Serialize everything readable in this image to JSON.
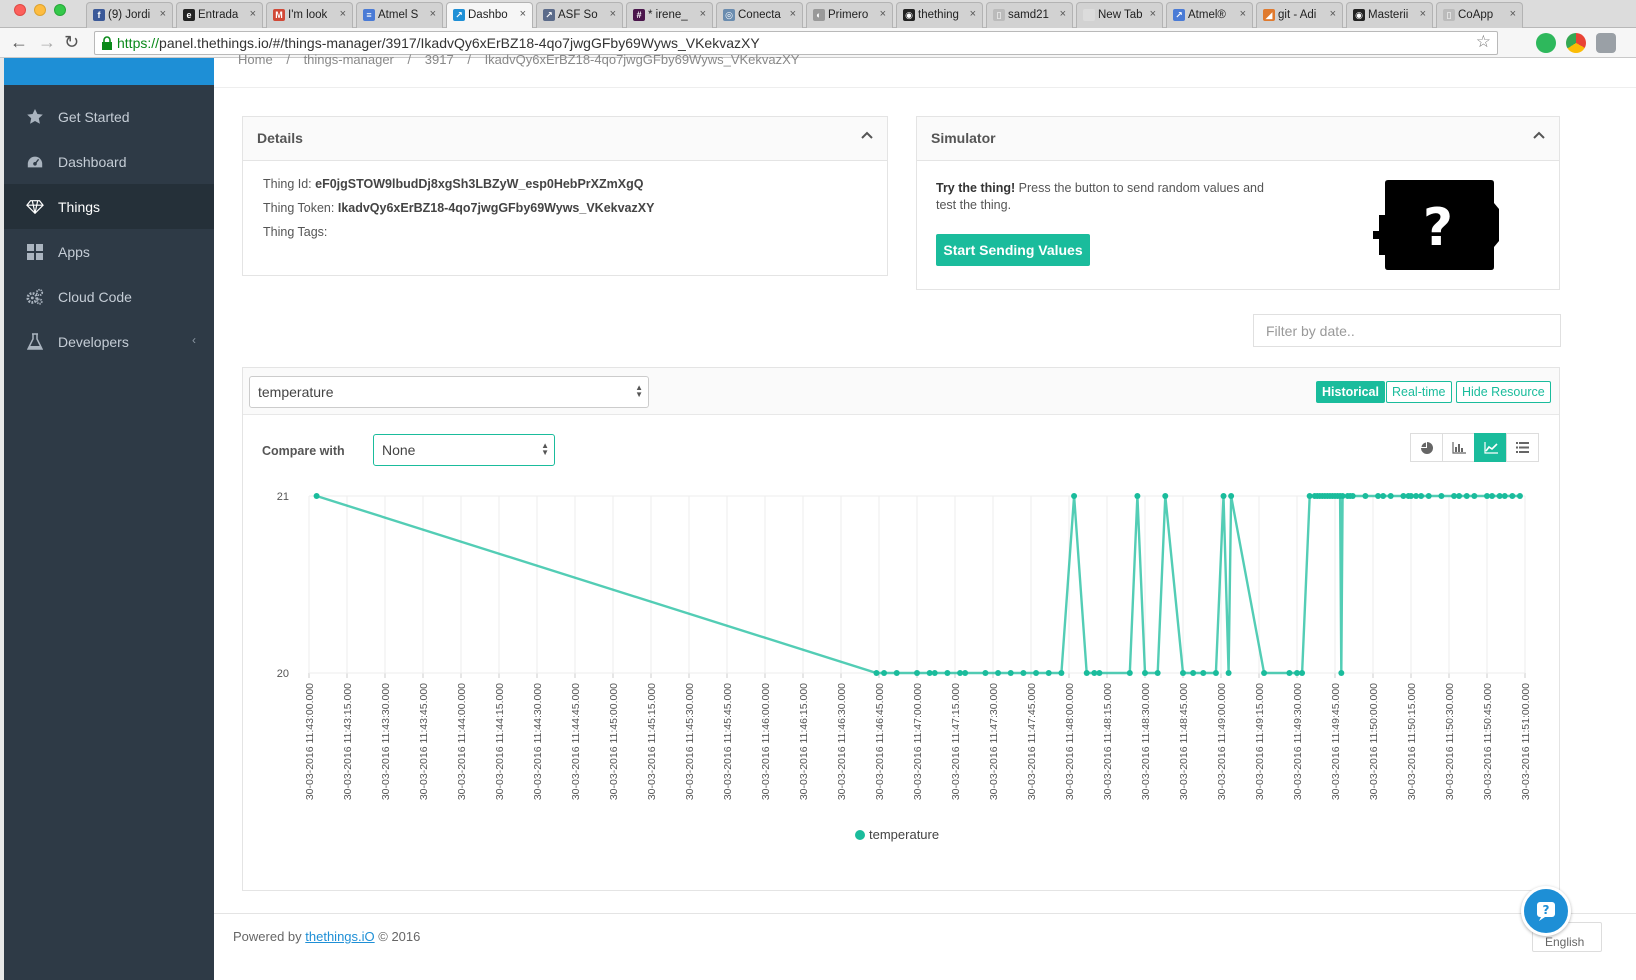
{
  "browser": {
    "tabs": [
      {
        "label": "(9) Jordi",
        "fav_color": "#3b5998",
        "fav_glyph": "f"
      },
      {
        "label": "Entrada",
        "fav_color": "#222222",
        "fav_glyph": "e"
      },
      {
        "label": "I'm look",
        "fav_color": "#d14836",
        "fav_glyph": "M"
      },
      {
        "label": "Atmel S",
        "fav_color": "#4a7bd6",
        "fav_glyph": "≡"
      },
      {
        "label": "Dashbo",
        "fav_color": "#1e8fd6",
        "fav_glyph": "↗",
        "active": true
      },
      {
        "label": "ASF So",
        "fav_color": "#5b6b8a",
        "fav_glyph": "↗"
      },
      {
        "label": "* irene_",
        "fav_color": "#4a154b",
        "fav_glyph": "#"
      },
      {
        "label": "Conecta",
        "fav_color": "#6a8caf",
        "fav_glyph": "◎"
      },
      {
        "label": "Primero",
        "fav_color": "#999999",
        "fav_glyph": "◐"
      },
      {
        "label": "thething",
        "fav_color": "#222222",
        "fav_glyph": "◉"
      },
      {
        "label": "samd21",
        "fav_color": "#bbbbbb",
        "fav_glyph": "▯"
      },
      {
        "label": "New Tab",
        "fav_color": "#dcdcdc",
        "fav_glyph": ""
      },
      {
        "label": "Atmel®",
        "fav_color": "#4a7bd6",
        "fav_glyph": "↗"
      },
      {
        "label": "git - Adi",
        "fav_color": "#e07a2e",
        "fav_glyph": "◢"
      },
      {
        "label": "Masterii",
        "fav_color": "#222222",
        "fav_glyph": "◉"
      },
      {
        "label": "CoApp",
        "fav_color": "#bbbbbb",
        "fav_glyph": "▯"
      }
    ],
    "url_scheme": "https://",
    "url_rest": "panel.thethings.io/#/things-manager/3917/IkadvQy6xErBZ18-4qo7jwgGFby69Wyws_VKekvazXY"
  },
  "sidebar": {
    "items": [
      {
        "label": "Get Started",
        "icon": "star-icon"
      },
      {
        "label": "Dashboard",
        "icon": "dashboard-icon"
      },
      {
        "label": "Things",
        "icon": "diamond-icon",
        "active": true
      },
      {
        "label": "Apps",
        "icon": "grid-icon"
      },
      {
        "label": "Cloud Code",
        "icon": "gears-icon"
      },
      {
        "label": "Developers",
        "icon": "flask-icon",
        "chevron": "‹"
      }
    ]
  },
  "breadcrumb": [
    "Home",
    "/",
    "things-manager",
    "/",
    "3917",
    "/",
    "IkadvQy6xErBZ18-4qo7jwgGFby69Wyws_VKekvazXY"
  ],
  "details": {
    "title": "Details",
    "thing_id_label": "Thing Id:",
    "thing_id": "eF0jgSTOW9lbudDj8xgSh3LBZyW_esp0HebPrXZmXgQ",
    "thing_token_label": "Thing Token:",
    "thing_token": "IkadvQy6xErBZ18-4qo7jwgGFby69Wyws_VKekvazXY",
    "thing_tags_label": "Thing Tags:"
  },
  "simulator": {
    "title": "Simulator",
    "lead": "Try the thing!",
    "text": "Press the button to send random values and test the thing.",
    "button": "Start Sending Values",
    "icon": "question-device-icon"
  },
  "filter": {
    "placeholder": "Filter by date.."
  },
  "chart_panel": {
    "resource": "temperature",
    "historical": "Historical",
    "realtime": "Real-time",
    "hide": "Hide Resource",
    "compare_label": "Compare with",
    "compare_value": "None",
    "chart_types": [
      "pie-chart-icon",
      "bar-chart-icon",
      "line-chart-icon",
      "list-icon"
    ],
    "active_chart_type": "line-chart-icon",
    "accent": "#1abc9c"
  },
  "chart_data": {
    "type": "line",
    "series": [
      {
        "name": "temperature"
      }
    ],
    "y_ticks": [
      "21",
      "20"
    ],
    "ylim": [
      20,
      21
    ],
    "xlim_seconds": [
      0,
      480
    ],
    "x_tick_labels": [
      "30-03-2016 11:43:00.000",
      "30-03-2016 11:43:15.000",
      "30-03-2016 11:43:30.000",
      "30-03-2016 11:43:45.000",
      "30-03-2016 11:44:00.000",
      "30-03-2016 11:44:15.000",
      "30-03-2016 11:44:30.000",
      "30-03-2016 11:44:45.000",
      "30-03-2016 11:45:00.000",
      "30-03-2016 11:45:15.000",
      "30-03-2016 11:45:30.000",
      "30-03-2016 11:45:45.000",
      "30-03-2016 11:46:00.000",
      "30-03-2016 11:46:15.000",
      "30-03-2016 11:46:30.000",
      "30-03-2016 11:46:45.000",
      "30-03-2016 11:47:00.000",
      "30-03-2016 11:47:15.000",
      "30-03-2016 11:47:30.000",
      "30-03-2016 11:47:45.000",
      "30-03-2016 11:48:00.000",
      "30-03-2016 11:48:15.000",
      "30-03-2016 11:48:30.000",
      "30-03-2016 11:48:45.000",
      "30-03-2016 11:49:00.000",
      "30-03-2016 11:49:15.000",
      "30-03-2016 11:49:30.000",
      "30-03-2016 11:49:45.000",
      "30-03-2016 11:50:00.000",
      "30-03-2016 11:50:15.000",
      "30-03-2016 11:50:30.000",
      "30-03-2016 11:50:45.000",
      "30-03-2016 11:51:00.000"
    ],
    "points": [
      [
        3,
        21
      ],
      [
        224,
        20
      ],
      [
        227,
        20
      ],
      [
        232,
        20
      ],
      [
        240,
        20
      ],
      [
        245,
        20
      ],
      [
        247,
        20
      ],
      [
        252,
        20
      ],
      [
        257,
        20
      ],
      [
        259,
        20
      ],
      [
        267,
        20
      ],
      [
        272,
        20
      ],
      [
        277,
        20
      ],
      [
        282,
        20
      ],
      [
        287,
        20
      ],
      [
        292,
        20
      ],
      [
        297,
        20
      ],
      [
        302,
        21
      ],
      [
        307,
        20
      ],
      [
        310,
        20
      ],
      [
        312,
        20
      ],
      [
        324,
        20
      ],
      [
        327,
        21
      ],
      [
        330,
        20
      ],
      [
        335,
        20
      ],
      [
        338,
        21
      ],
      [
        345,
        20
      ],
      [
        349,
        20
      ],
      [
        353,
        20
      ],
      [
        358,
        20
      ],
      [
        361,
        21
      ],
      [
        363,
        20
      ],
      [
        364,
        21
      ],
      [
        377,
        20
      ],
      [
        387,
        20
      ],
      [
        390,
        20
      ],
      [
        392,
        20
      ],
      [
        395,
        21
      ],
      [
        397,
        21
      ],
      [
        398,
        21
      ],
      [
        399,
        21
      ],
      [
        400,
        21
      ],
      [
        401,
        21
      ],
      [
        402,
        21
      ],
      [
        403,
        21
      ],
      [
        404,
        21
      ],
      [
        405,
        21
      ],
      [
        406,
        21
      ],
      [
        407,
        21
      ],
      [
        407.5,
        20
      ],
      [
        408,
        21
      ],
      [
        410,
        21
      ],
      [
        411,
        21
      ],
      [
        412,
        21
      ],
      [
        417,
        21
      ],
      [
        422,
        21
      ],
      [
        424,
        21
      ],
      [
        427,
        21
      ],
      [
        432,
        21
      ],
      [
        434,
        21
      ],
      [
        435,
        21
      ],
      [
        437,
        21
      ],
      [
        439,
        21
      ],
      [
        442,
        21
      ],
      [
        447,
        21
      ],
      [
        452,
        21
      ],
      [
        454,
        21
      ],
      [
        457,
        21
      ],
      [
        460,
        21
      ],
      [
        465,
        21
      ],
      [
        467,
        21
      ],
      [
        470,
        21
      ],
      [
        472,
        21
      ],
      [
        475,
        21
      ],
      [
        478,
        21
      ]
    ]
  },
  "footer": {
    "prefix": "Powered by ",
    "link": "thethings.iO",
    "suffix": " © 2016",
    "language": "English"
  }
}
